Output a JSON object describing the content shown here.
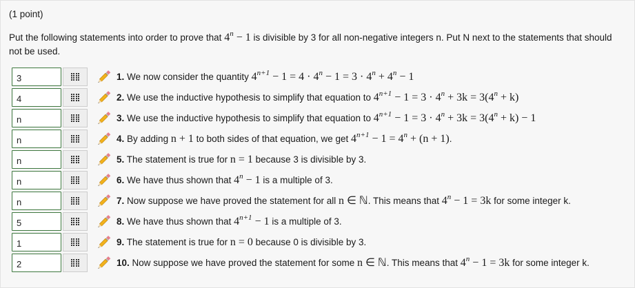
{
  "points": "(1 point)",
  "problem": {
    "p1": "Put the following statements into order to prove that ",
    "m1": "4",
    "m1_sup": "n",
    "m1b": " − 1",
    "p2": " is divisible by 3 for all non-negative integers n. Put N next to the statements that should not be used."
  },
  "icons": {
    "handle": "grid-icon",
    "hint": "pencil-icon"
  },
  "colors": {
    "input_border": "#3c763d",
    "handle_bg": "#eeeeee"
  },
  "rows": [
    {
      "value": "3",
      "num": "1.",
      "t1": "We now consider the quantity ",
      "m1": "4",
      "m1s": "n+1",
      "m1b": " − 1 = 4 · 4",
      "m1bs": "n",
      "m1c": " − 1 = 3 · 4",
      "m1cs": "n",
      "m1d": " + 4",
      "m1ds": "n",
      "m1e": " − 1"
    },
    {
      "value": "4",
      "num": "2.",
      "t1": "We use the inductive hypothesis to simplify that equation to ",
      "m1": "4",
      "m1s": "n+1",
      "m1b": " − 1 = 3 · 4",
      "m1bs": "n",
      "m1c": " + 3k = 3(4",
      "m1cs": "n",
      "m1d": " + k)"
    },
    {
      "value": "n",
      "num": "3.",
      "t1": "We use the inductive hypothesis to simplify that equation to ",
      "m1": "4",
      "m1s": "n+1",
      "m1b": " − 1 = 3 · 4",
      "m1bs": "n",
      "m1c": " + 3k = 3(4",
      "m1cs": "n",
      "m1d": " + k) − 1"
    },
    {
      "value": "n",
      "num": "4.",
      "t1": "By adding ",
      "m1": "n + 1",
      "t2": " to both sides of that equation, we get ",
      "m2": "4",
      "m2s": "n+1",
      "m2b": " − 1 = 4",
      "m2bs": "n",
      "m2c": " + (n + 1)",
      "t3": "."
    },
    {
      "value": "n",
      "num": "5.",
      "t1": "The statement is true for ",
      "m1": "n = 1",
      "t2": " because 3 is divisible by 3."
    },
    {
      "value": "n",
      "num": "6.",
      "t1": "We have thus shown that ",
      "m1": "4",
      "m1s": "n",
      "m1b": " − 1",
      "t2": " is a multiple of 3."
    },
    {
      "value": "n",
      "num": "7.",
      "t1": "Now suppose we have proved the statement for all ",
      "m1": "n ∈ ℕ",
      "t2": ". This means that ",
      "m2": "4",
      "m2s": "n",
      "m2b": " − 1 = 3k",
      "t3": " for some integer k."
    },
    {
      "value": "5",
      "num": "8.",
      "t1": "We have thus shown that ",
      "m1": "4",
      "m1s": "n+1",
      "m1b": " − 1",
      "t2": " is a multiple of 3."
    },
    {
      "value": "1",
      "num": "9.",
      "t1": "The statement is true for ",
      "m1": "n = 0",
      "t2": " because 0 is divisible by 3."
    },
    {
      "value": "2",
      "num": "10.",
      "t1": "Now suppose we have proved the statement for some ",
      "m1": "n ∈ ℕ",
      "t2": ". This means that ",
      "m2": "4",
      "m2s": "n",
      "m2b": " − 1 = 3k",
      "t3": " for some integer k."
    }
  ]
}
